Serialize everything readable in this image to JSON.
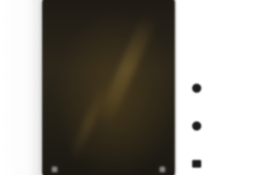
{
  "media": {
    "caption": "",
    "accent_color": "#c9a548"
  },
  "actions": [
    {
      "icon": "heart-icon",
      "count": ""
    },
    {
      "icon": "comment-icon",
      "count": ""
    },
    {
      "icon": "share-icon",
      "count": ""
    }
  ]
}
